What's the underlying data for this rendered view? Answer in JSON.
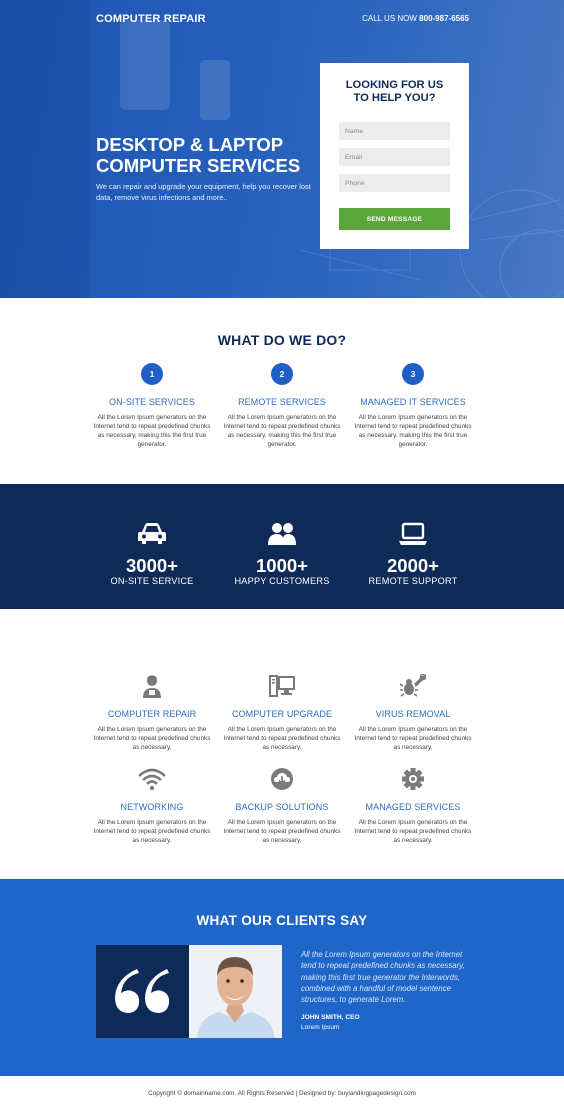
{
  "header": {
    "brand": "COMPUTER REPAIR",
    "call_label": "CALL US NOW",
    "phone": "800-987-6565"
  },
  "hero": {
    "title": "DESKTOP & LAPTOP COMPUTER SERVICES",
    "subtitle": "We can repair and upgrade your equipment, help you recover lost data, remove virus infections and more..",
    "background_color": "#1e56b3"
  },
  "form": {
    "title": "LOOKING FOR US TO HELP YOU?",
    "name_placeholder": "Name",
    "email_placeholder": "Email",
    "phone_placeholder": "Phone",
    "submit_label": "SEND MESSAGE",
    "submit_color": "#5ba63a"
  },
  "what_we_do": {
    "title": "WHAT DO WE DO?",
    "steps": [
      {
        "num": "1",
        "title": "ON-SITE SERVICES",
        "desc": "All the Lorem Ipsum generators on the Internet tend to repeat predefined chunks as necessary, making this the first true generator."
      },
      {
        "num": "2",
        "title": "REMOTE SERVICES",
        "desc": "All the Lorem Ipsum generators on the Internet tend to repeat predefined chunks as necessary, making this the first true generator."
      },
      {
        "num": "3",
        "title": "MANAGED IT SERVICES",
        "desc": "All the Lorem Ipsum generators on the Internet tend to repeat predefined chunks as necessary, making this the first true generator."
      }
    ]
  },
  "stats": [
    {
      "icon": "car-icon",
      "number": "3000+",
      "label": "ON-SITE SERVICE"
    },
    {
      "icon": "users-icon",
      "number": "1000+",
      "label": "HAPPY CUSTOMERS"
    },
    {
      "icon": "laptop-icon",
      "number": "2000+",
      "label": "REMOTE SUPPORT"
    }
  ],
  "services": [
    {
      "icon": "technician-icon",
      "title": "COMPUTER REPAIR",
      "desc": "All the Lorem Ipsum generators on the Internet tend to repeat predefined chunks as necessary."
    },
    {
      "icon": "computer-upgrade-icon",
      "title": "COMPUTER UPGRADE",
      "desc": "All the Lorem Ipsum generators on the Internet tend to repeat predefined chunks as necessary."
    },
    {
      "icon": "bug-wrench-icon",
      "title": "VIRUS REMOVAL",
      "desc": "All the Lorem Ipsum generators on the Internet tend to repeat predefined chunks as necessary."
    },
    {
      "icon": "wifi-icon",
      "title": "NETWORKING",
      "desc": "All the Lorem Ipsum generators on the Internet tend to repeat predefined chunks as necessary."
    },
    {
      "icon": "cloud-download-icon",
      "title": "BACKUP SOLUTIONS",
      "desc": "All the Lorem Ipsum generators on the Internet tend to repeat predefined chunks as necessary."
    },
    {
      "icon": "gear-icon",
      "title": "MANAGED SERVICES",
      "desc": "All the Lorem Ipsum generators on the Internet tend to repeat predefined chunks as necessary."
    }
  ],
  "testimonial": {
    "title": "WHAT OUR CLIENTS SAY",
    "quote": "All the Lorem Ipsum generators on the Internet tend to repeat predefined chunks as necessary, making this first true generator the Interwords, combined with a handful of model sentence structures, to generate Lorem.",
    "author": "JOHN SMITH, CEO",
    "role": "Lorem Ipsum",
    "background_color": "#1f66c9"
  },
  "footer": {
    "text": "Copyright © domainname.com. All Rights Reserved  |  Designed by: buylandingpagedesign.com"
  }
}
